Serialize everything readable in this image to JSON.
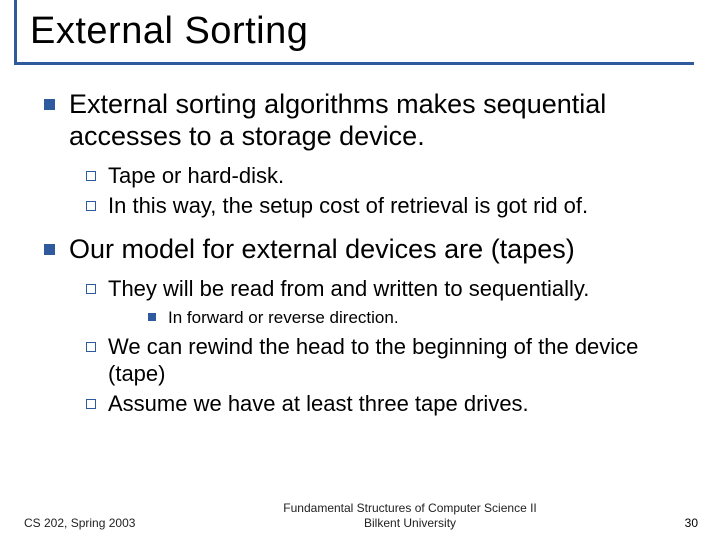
{
  "title": "External Sorting",
  "bullets": [
    {
      "text": "External sorting algorithms  makes sequential accesses to a storage device.",
      "children": [
        {
          "text": "Tape or hard-disk."
        },
        {
          "text": "In this way, the setup cost of retrieval is got rid of."
        }
      ]
    },
    {
      "text": "Our model for external devices are (tapes)",
      "children": [
        {
          "text": "They will be read from and written to sequentially.",
          "children": [
            {
              "text": "In forward or reverse direction."
            }
          ]
        },
        {
          "text": "We can rewind the head to the beginning of the device (tape)"
        },
        {
          "text": "Assume we have at least three tape drives."
        }
      ]
    }
  ],
  "footer": {
    "left": "CS 202, Spring 2003",
    "center_line1": "Fundamental Structures of Computer Science II",
    "center_line2": "Bilkent University",
    "page": "30"
  },
  "colors": {
    "accent": "#2f5a9e"
  }
}
